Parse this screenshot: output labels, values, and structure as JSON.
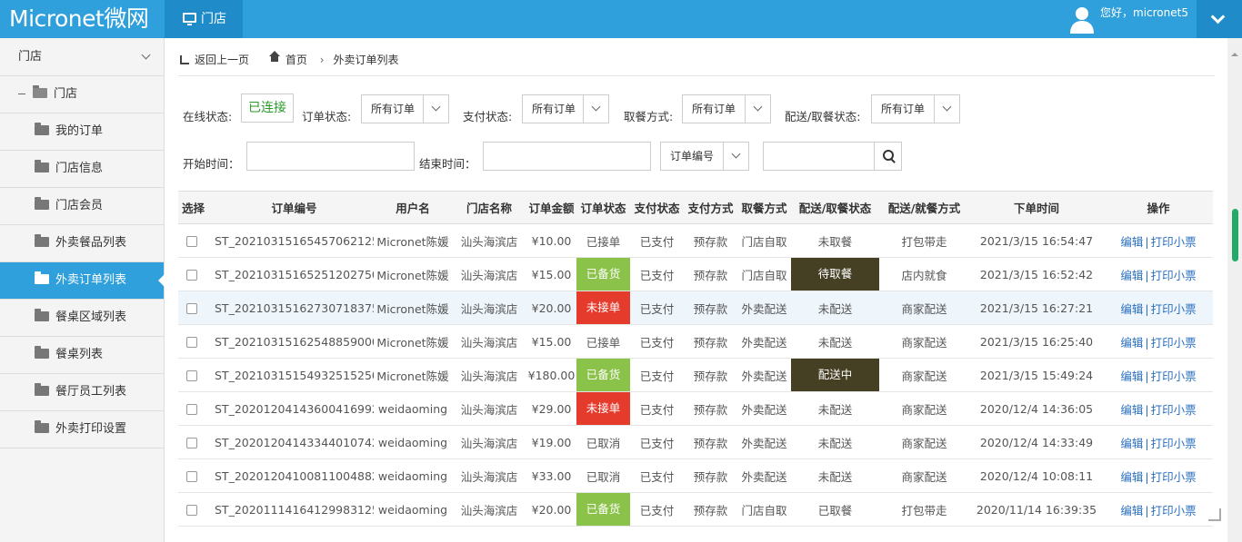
{
  "header": {
    "brand": "Micronet微网",
    "nav_label": "门店",
    "greeting": "您好，micronet5"
  },
  "sidebar": {
    "head": "门店",
    "group": "门店",
    "items": [
      {
        "label": "我的订单"
      },
      {
        "label": "门店信息"
      },
      {
        "label": "门店会员"
      },
      {
        "label": "外卖餐品列表"
      },
      {
        "label": "外卖订单列表"
      },
      {
        "label": "餐桌区域列表"
      },
      {
        "label": "餐桌列表"
      },
      {
        "label": "餐厅员工列表"
      },
      {
        "label": "外卖打印设置"
      }
    ],
    "active_index": 4
  },
  "breadcrumb": {
    "back": "返回上一页",
    "home": "首页",
    "current": "外卖订单列表"
  },
  "filters": {
    "online_label": "在线状态:",
    "online_value": "已连接",
    "order_status_label": "订单状态:",
    "order_status_value": "所有订单",
    "pay_status_label": "支付状态:",
    "pay_status_value": "所有订单",
    "pickup_label": "取餐方式:",
    "pickup_value": "所有订单",
    "delivery_label": "配送/取餐状态:",
    "delivery_value": "所有订单",
    "start_label": "开始时间：",
    "end_label": "结束时间：",
    "search_field_value": "订单编号"
  },
  "table": {
    "headers": [
      "选择",
      "订单编号",
      "用户名",
      "门店名称",
      "订单金额",
      "订单状态",
      "支付状态",
      "支付方式",
      "取餐方式",
      "配送/取餐状态",
      "配送/就餐方式",
      "下单时间",
      "操作"
    ],
    "edit_label": "编辑",
    "print_label": "打印小票",
    "rows": [
      {
        "id": "ST_20210315165457062125",
        "user": "Micronet陈媛",
        "store": "汕头海滨店",
        "amount": "¥10.00",
        "status": "已接单",
        "pay": "已支付",
        "method": "预存款",
        "pickup": "门店自取",
        "dstatus": "未取餐",
        "dmode": "打包带走",
        "time": "2021/3/15 16:54:47"
      },
      {
        "id": "ST_20210315165251202750",
        "user": "Micronet陈媛",
        "store": "汕头海滨店",
        "amount": "¥15.00",
        "status": "已备货",
        "pay": "已支付",
        "method": "预存款",
        "pickup": "门店自取",
        "dstatus": "待取餐",
        "dmode": "店内就食",
        "time": "2021/3/15 16:52:42"
      },
      {
        "id": "ST_20210315162730718375",
        "user": "Micronet陈媛",
        "store": "汕头海滨店",
        "amount": "¥20.00",
        "status": "未接单",
        "pay": "已支付",
        "method": "预存款",
        "pickup": "外卖配送",
        "dstatus": "未配送",
        "dmode": "商家配送",
        "time": "2021/3/15 16:27:21"
      },
      {
        "id": "ST_20210315162548859000",
        "user": "Micronet陈媛",
        "store": "汕头海滨店",
        "amount": "¥15.00",
        "status": "已接单",
        "pay": "已支付",
        "method": "预存款",
        "pickup": "外卖配送",
        "dstatus": "未配送",
        "dmode": "商家配送",
        "time": "2021/3/15 16:25:40"
      },
      {
        "id": "ST_20210315154932515250",
        "user": "Micronet陈媛",
        "store": "汕头海滨店",
        "amount": "¥180.00",
        "status": "已备货",
        "pay": "已支付",
        "method": "预存款",
        "pickup": "外卖配送",
        "dstatus": "配送中",
        "dmode": "商家配送",
        "time": "2021/3/15 15:49:24"
      },
      {
        "id": "ST_20201204143600416992",
        "user": "weidaoming",
        "store": "汕头海滨店",
        "amount": "¥29.00",
        "status": "未接单",
        "pay": "已支付",
        "method": "预存款",
        "pickup": "外卖配送",
        "dstatus": "未配送",
        "dmode": "商家配送",
        "time": "2020/12/4 14:36:05"
      },
      {
        "id": "ST_20201204143344010742",
        "user": "weidaoming",
        "store": "汕头海滨店",
        "amount": "¥19.00",
        "status": "已取消",
        "pay": "已支付",
        "method": "预存款",
        "pickup": "外卖配送",
        "dstatus": "未配送",
        "dmode": "商家配送",
        "time": "2020/12/4 14:33:49"
      },
      {
        "id": "ST_20201204100811004882",
        "user": "weidaoming",
        "store": "汕头海滨店",
        "amount": "¥33.00",
        "status": "已取消",
        "pay": "已支付",
        "method": "预存款",
        "pickup": "外卖配送",
        "dstatus": "未配送",
        "dmode": "商家配送",
        "time": "2020/12/4 10:08:11"
      },
      {
        "id": "ST_20201114164129983125",
        "user": "weidaoming",
        "store": "汕头海滨店",
        "amount": "¥20.00",
        "status": "已备货",
        "pay": "已支付",
        "method": "预存款",
        "pickup": "门店自取",
        "dstatus": "已取餐",
        "dmode": "打包带走",
        "time": "2020/11/14 16:39:35"
      }
    ]
  }
}
